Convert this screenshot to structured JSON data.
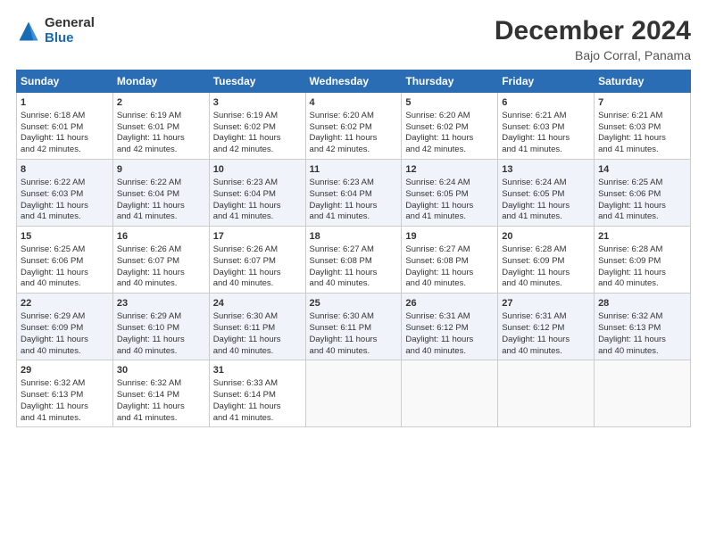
{
  "logo": {
    "general": "General",
    "blue": "Blue"
  },
  "title": "December 2024",
  "location": "Bajo Corral, Panama",
  "days_header": [
    "Sunday",
    "Monday",
    "Tuesday",
    "Wednesday",
    "Thursday",
    "Friday",
    "Saturday"
  ],
  "weeks": [
    [
      {
        "day": "1",
        "sunrise": "Sunrise: 6:18 AM",
        "sunset": "Sunset: 6:01 PM",
        "daylight": "Daylight: 11 hours and 42 minutes."
      },
      {
        "day": "2",
        "sunrise": "Sunrise: 6:19 AM",
        "sunset": "Sunset: 6:01 PM",
        "daylight": "Daylight: 11 hours and 42 minutes."
      },
      {
        "day": "3",
        "sunrise": "Sunrise: 6:19 AM",
        "sunset": "Sunset: 6:02 PM",
        "daylight": "Daylight: 11 hours and 42 minutes."
      },
      {
        "day": "4",
        "sunrise": "Sunrise: 6:20 AM",
        "sunset": "Sunset: 6:02 PM",
        "daylight": "Daylight: 11 hours and 42 minutes."
      },
      {
        "day": "5",
        "sunrise": "Sunrise: 6:20 AM",
        "sunset": "Sunset: 6:02 PM",
        "daylight": "Daylight: 11 hours and 42 minutes."
      },
      {
        "day": "6",
        "sunrise": "Sunrise: 6:21 AM",
        "sunset": "Sunset: 6:03 PM",
        "daylight": "Daylight: 11 hours and 41 minutes."
      },
      {
        "day": "7",
        "sunrise": "Sunrise: 6:21 AM",
        "sunset": "Sunset: 6:03 PM",
        "daylight": "Daylight: 11 hours and 41 minutes."
      }
    ],
    [
      {
        "day": "8",
        "sunrise": "Sunrise: 6:22 AM",
        "sunset": "Sunset: 6:03 PM",
        "daylight": "Daylight: 11 hours and 41 minutes."
      },
      {
        "day": "9",
        "sunrise": "Sunrise: 6:22 AM",
        "sunset": "Sunset: 6:04 PM",
        "daylight": "Daylight: 11 hours and 41 minutes."
      },
      {
        "day": "10",
        "sunrise": "Sunrise: 6:23 AM",
        "sunset": "Sunset: 6:04 PM",
        "daylight": "Daylight: 11 hours and 41 minutes."
      },
      {
        "day": "11",
        "sunrise": "Sunrise: 6:23 AM",
        "sunset": "Sunset: 6:04 PM",
        "daylight": "Daylight: 11 hours and 41 minutes."
      },
      {
        "day": "12",
        "sunrise": "Sunrise: 6:24 AM",
        "sunset": "Sunset: 6:05 PM",
        "daylight": "Daylight: 11 hours and 41 minutes."
      },
      {
        "day": "13",
        "sunrise": "Sunrise: 6:24 AM",
        "sunset": "Sunset: 6:05 PM",
        "daylight": "Daylight: 11 hours and 41 minutes."
      },
      {
        "day": "14",
        "sunrise": "Sunrise: 6:25 AM",
        "sunset": "Sunset: 6:06 PM",
        "daylight": "Daylight: 11 hours and 41 minutes."
      }
    ],
    [
      {
        "day": "15",
        "sunrise": "Sunrise: 6:25 AM",
        "sunset": "Sunset: 6:06 PM",
        "daylight": "Daylight: 11 hours and 40 minutes."
      },
      {
        "day": "16",
        "sunrise": "Sunrise: 6:26 AM",
        "sunset": "Sunset: 6:07 PM",
        "daylight": "Daylight: 11 hours and 40 minutes."
      },
      {
        "day": "17",
        "sunrise": "Sunrise: 6:26 AM",
        "sunset": "Sunset: 6:07 PM",
        "daylight": "Daylight: 11 hours and 40 minutes."
      },
      {
        "day": "18",
        "sunrise": "Sunrise: 6:27 AM",
        "sunset": "Sunset: 6:08 PM",
        "daylight": "Daylight: 11 hours and 40 minutes."
      },
      {
        "day": "19",
        "sunrise": "Sunrise: 6:27 AM",
        "sunset": "Sunset: 6:08 PM",
        "daylight": "Daylight: 11 hours and 40 minutes."
      },
      {
        "day": "20",
        "sunrise": "Sunrise: 6:28 AM",
        "sunset": "Sunset: 6:09 PM",
        "daylight": "Daylight: 11 hours and 40 minutes."
      },
      {
        "day": "21",
        "sunrise": "Sunrise: 6:28 AM",
        "sunset": "Sunset: 6:09 PM",
        "daylight": "Daylight: 11 hours and 40 minutes."
      }
    ],
    [
      {
        "day": "22",
        "sunrise": "Sunrise: 6:29 AM",
        "sunset": "Sunset: 6:09 PM",
        "daylight": "Daylight: 11 hours and 40 minutes."
      },
      {
        "day": "23",
        "sunrise": "Sunrise: 6:29 AM",
        "sunset": "Sunset: 6:10 PM",
        "daylight": "Daylight: 11 hours and 40 minutes."
      },
      {
        "day": "24",
        "sunrise": "Sunrise: 6:30 AM",
        "sunset": "Sunset: 6:11 PM",
        "daylight": "Daylight: 11 hours and 40 minutes."
      },
      {
        "day": "25",
        "sunrise": "Sunrise: 6:30 AM",
        "sunset": "Sunset: 6:11 PM",
        "daylight": "Daylight: 11 hours and 40 minutes."
      },
      {
        "day": "26",
        "sunrise": "Sunrise: 6:31 AM",
        "sunset": "Sunset: 6:12 PM",
        "daylight": "Daylight: 11 hours and 40 minutes."
      },
      {
        "day": "27",
        "sunrise": "Sunrise: 6:31 AM",
        "sunset": "Sunset: 6:12 PM",
        "daylight": "Daylight: 11 hours and 40 minutes."
      },
      {
        "day": "28",
        "sunrise": "Sunrise: 6:32 AM",
        "sunset": "Sunset: 6:13 PM",
        "daylight": "Daylight: 11 hours and 40 minutes."
      }
    ],
    [
      {
        "day": "29",
        "sunrise": "Sunrise: 6:32 AM",
        "sunset": "Sunset: 6:13 PM",
        "daylight": "Daylight: 11 hours and 41 minutes."
      },
      {
        "day": "30",
        "sunrise": "Sunrise: 6:32 AM",
        "sunset": "Sunset: 6:14 PM",
        "daylight": "Daylight: 11 hours and 41 minutes."
      },
      {
        "day": "31",
        "sunrise": "Sunrise: 6:33 AM",
        "sunset": "Sunset: 6:14 PM",
        "daylight": "Daylight: 11 hours and 41 minutes."
      },
      null,
      null,
      null,
      null
    ]
  ]
}
